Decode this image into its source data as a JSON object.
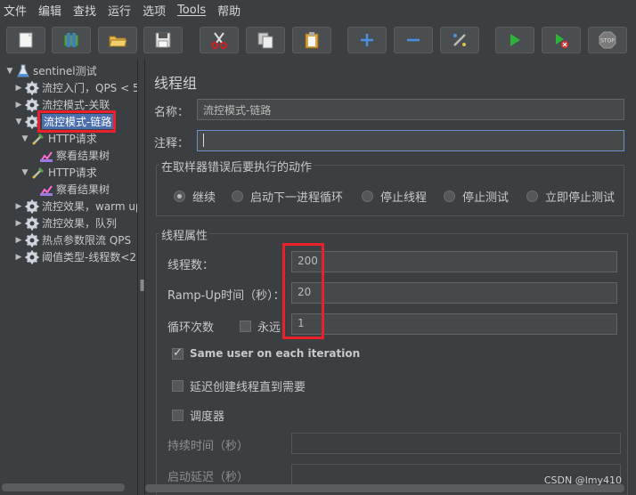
{
  "menu": [
    "文件",
    "编辑",
    "查找",
    "运行",
    "选项",
    "Tools",
    "帮助"
  ],
  "toolbar_icons": [
    "new-icon",
    "templates-icon",
    "open-icon",
    "save-icon",
    "cut-icon",
    "copy-icon",
    "paste-icon",
    "expand-icon",
    "collapse-icon",
    "toggle-icon",
    "start-icon",
    "start-no-pause-icon",
    "stop-icon"
  ],
  "toolbar_stop_label": "STOP",
  "tree": [
    {
      "label": "sentinel测试",
      "level": 0,
      "icon": "test-plan-icon",
      "expanded": true
    },
    {
      "label": "流控入门，QPS < 5",
      "level": 1,
      "icon": "thread-group-gear-icon",
      "expanded": false
    },
    {
      "label": "流控模式-关联",
      "level": 1,
      "icon": "thread-group-gear-icon",
      "expanded": false
    },
    {
      "label": "流控模式-链路",
      "level": 1,
      "icon": "thread-group-gear-icon",
      "expanded": true,
      "selected": true
    },
    {
      "label": "HTTP请求",
      "level": 2,
      "icon": "http-sampler-icon",
      "expanded": true
    },
    {
      "label": "察看结果树",
      "level": 3,
      "icon": "result-tree-icon"
    },
    {
      "label": "HTTP请求",
      "level": 2,
      "icon": "http-sampler-icon",
      "expanded": true
    },
    {
      "label": "察看结果树",
      "level": 3,
      "icon": "result-tree-icon"
    },
    {
      "label": "流控效果，warm up",
      "level": 1,
      "icon": "thread-group-gear-icon",
      "expanded": false
    },
    {
      "label": "流控效果，队列",
      "level": 1,
      "icon": "thread-group-gear-icon",
      "expanded": false
    },
    {
      "label": "热点参数限流 QPS",
      "level": 1,
      "icon": "thread-group-gear-icon",
      "expanded": false
    },
    {
      "label": "阈值类型-线程数<2",
      "level": 1,
      "icon": "thread-group-gear-icon",
      "expanded": false
    }
  ],
  "panel": {
    "title": "线程组",
    "name_label": "名称：",
    "name_value": "流控模式-链路",
    "comment_label": "注释：",
    "comment_value": "",
    "error_group_title": "在取样器错误后要执行的动作",
    "error_actions": [
      {
        "label": "继续",
        "selected": true
      },
      {
        "label": "启动下一进程循环",
        "selected": false
      },
      {
        "label": "停止线程",
        "selected": false
      },
      {
        "label": "停止测试",
        "selected": false
      },
      {
        "label": "立即停止测试",
        "selected": false
      }
    ],
    "props_title": "线程属性",
    "threads_label": "线程数：",
    "threads_value": "200",
    "rampup_label": "Ramp-Up时间（秒）：",
    "rampup_value": "20",
    "loop_label": "循环次数",
    "forever_label": "永远",
    "forever_checked": false,
    "loop_value": "1",
    "same_user_label": "Same user on each iteration",
    "same_user_checked": true,
    "delay_label": "延迟创建线程直到需要",
    "delay_checked": false,
    "scheduler_label": "调度器",
    "scheduler_checked": false,
    "duration_label": "持续时间（秒）",
    "duration_value": "",
    "startup_delay_label": "启动延迟（秒）",
    "startup_delay_value": ""
  },
  "watermark": "CSDN @lmy410",
  "colors": {
    "background": "#3c3f41",
    "selection": "#4b6eaf",
    "highlight_box": "#e8212b"
  }
}
